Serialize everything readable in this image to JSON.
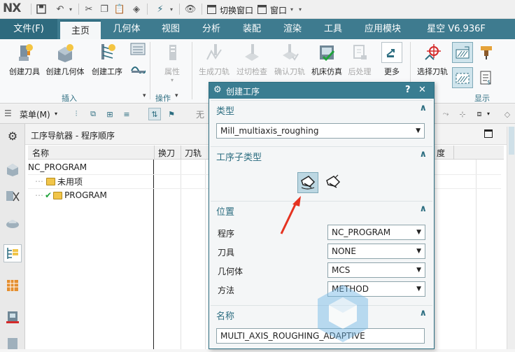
{
  "app": {
    "logo": "NX"
  },
  "quick_access": {
    "switch_window": "切换窗口",
    "window": "窗口"
  },
  "tabs": [
    {
      "label": "文件(F)"
    },
    {
      "label": "主页"
    },
    {
      "label": "几何体"
    },
    {
      "label": "视图"
    },
    {
      "label": "分析"
    },
    {
      "label": "装配"
    },
    {
      "label": "渲染"
    },
    {
      "label": "工具"
    },
    {
      "label": "应用模块"
    },
    {
      "label": "星空 V6.936F"
    }
  ],
  "ribbon": {
    "create_tool": "创建刀具",
    "create_geometry": "创建几何体",
    "create_operation": "创建工序",
    "attribute": "属性",
    "generate_toolpath": "生成刀轨",
    "verify_overcut": "过切检查",
    "confirm_toolpath": "确认刀轨",
    "machine_sim": "机床仿真",
    "postprocess": "后处理",
    "more": "更多",
    "select_toolpath": "选择刀轨",
    "group_insert": "插入",
    "group_operation": "操作",
    "group_display": "显示"
  },
  "menubar": {
    "menu": "菜单(M)",
    "filter_partial": "无"
  },
  "navigator": {
    "title": "工序导航器 - 程序顺序",
    "columns": [
      "名称",
      "换刀",
      "刀轨",
      "度"
    ],
    "rows": [
      {
        "label": "NC_PROGRAM"
      },
      {
        "label": "未用项"
      },
      {
        "label": "PROGRAM"
      }
    ]
  },
  "dialog": {
    "title": "创建工序",
    "help": "?",
    "close": "✕",
    "type_section": "类型",
    "type_value": "Mill_multiaxis_roughing",
    "subtype_section": "工序子类型",
    "location_section": "位置",
    "program_label": "程序",
    "program_value": "NC_PROGRAM",
    "tool_label": "刀具",
    "tool_value": "NONE",
    "geometry_label": "几何体",
    "geometry_value": "MCS",
    "method_label": "方法",
    "method_value": "METHOD",
    "name_section": "名称",
    "name_value": "MULTI_AXIS_ROUGHING_ADAPTIVE"
  },
  "colors": {
    "tab_bar": "#3e7b8f",
    "dialog_title": "#3a7d91",
    "accent_text": "#2c6d80",
    "annotation_arrow": "#e53321"
  }
}
